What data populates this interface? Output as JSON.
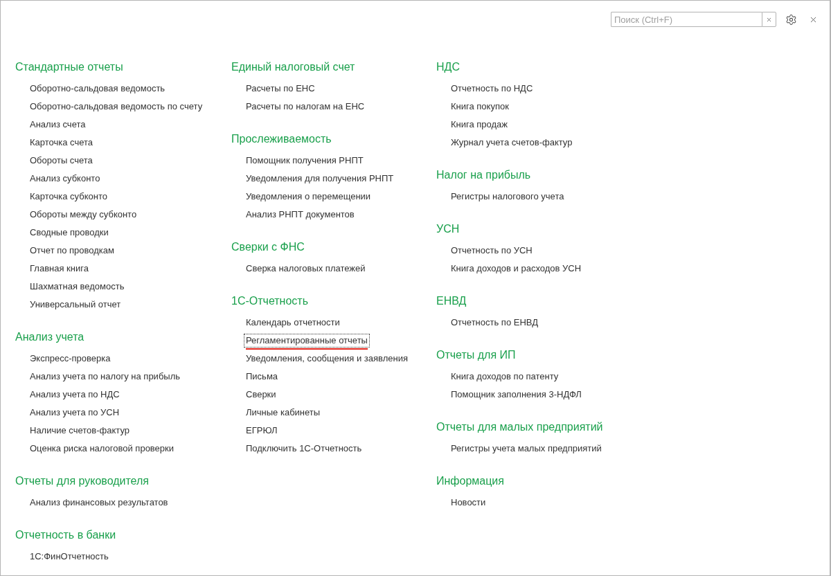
{
  "search": {
    "placeholder": "Поиск (Ctrl+F)"
  },
  "columns": [
    {
      "sections": [
        {
          "title": "Стандартные отчеты",
          "items": [
            {
              "label": "Оборотно-сальдовая ведомость",
              "selected": false
            },
            {
              "label": "Оборотно-сальдовая ведомость по счету",
              "selected": false
            },
            {
              "label": "Анализ счета",
              "selected": false
            },
            {
              "label": "Карточка счета",
              "selected": false
            },
            {
              "label": "Обороты счета",
              "selected": false
            },
            {
              "label": "Анализ субконто",
              "selected": false
            },
            {
              "label": "Карточка субконто",
              "selected": false
            },
            {
              "label": "Обороты между субконто",
              "selected": false
            },
            {
              "label": "Сводные проводки",
              "selected": false
            },
            {
              "label": "Отчет по проводкам",
              "selected": false
            },
            {
              "label": "Главная книга",
              "selected": false
            },
            {
              "label": "Шахматная ведомость",
              "selected": false
            },
            {
              "label": "Универсальный отчет",
              "selected": false
            }
          ]
        },
        {
          "title": "Анализ учета",
          "items": [
            {
              "label": "Экспресс-проверка",
              "selected": false
            },
            {
              "label": "Анализ учета по налогу на прибыль",
              "selected": false
            },
            {
              "label": "Анализ учета по НДС",
              "selected": false
            },
            {
              "label": "Анализ учета по УСН",
              "selected": false
            },
            {
              "label": "Наличие счетов-фактур",
              "selected": false
            },
            {
              "label": "Оценка риска налоговой проверки",
              "selected": false
            }
          ]
        },
        {
          "title": "Отчеты для руководителя",
          "items": [
            {
              "label": "Анализ финансовых результатов",
              "selected": false
            }
          ]
        },
        {
          "title": "Отчетность в банки",
          "items": [
            {
              "label": "1С:ФинОтчетность",
              "selected": false
            }
          ]
        }
      ]
    },
    {
      "sections": [
        {
          "title": "Единый налоговый счет",
          "items": [
            {
              "label": "Расчеты по ЕНС",
              "selected": false
            },
            {
              "label": "Расчеты по налогам на ЕНС",
              "selected": false
            }
          ]
        },
        {
          "title": "Прослеживаемость",
          "items": [
            {
              "label": "Помощник получения РНПТ",
              "selected": false
            },
            {
              "label": "Уведомления для получения РНПТ",
              "selected": false
            },
            {
              "label": "Уведомления о перемещении",
              "selected": false
            },
            {
              "label": "Анализ РНПТ документов",
              "selected": false
            }
          ]
        },
        {
          "title": "Сверки с ФНС",
          "items": [
            {
              "label": "Сверка налоговых платежей",
              "selected": false
            }
          ]
        },
        {
          "title": "1С-Отчетность",
          "items": [
            {
              "label": "Календарь отчетности",
              "selected": false
            },
            {
              "label": "Регламентированные отчеты",
              "selected": true
            },
            {
              "label": "Уведомления, сообщения и заявления",
              "selected": false
            },
            {
              "label": "Письма",
              "selected": false
            },
            {
              "label": "Сверки",
              "selected": false
            },
            {
              "label": "Личные кабинеты",
              "selected": false
            },
            {
              "label": "ЕГРЮЛ",
              "selected": false
            },
            {
              "label": "Подключить 1С-Отчетность",
              "selected": false
            }
          ]
        }
      ]
    },
    {
      "sections": [
        {
          "title": "НДС",
          "items": [
            {
              "label": "Отчетность по НДС",
              "selected": false
            },
            {
              "label": "Книга покупок",
              "selected": false
            },
            {
              "label": "Книга продаж",
              "selected": false
            },
            {
              "label": "Журнал учета счетов-фактур",
              "selected": false
            }
          ]
        },
        {
          "title": "Налог на прибыль",
          "items": [
            {
              "label": "Регистры налогового учета",
              "selected": false
            }
          ]
        },
        {
          "title": "УСН",
          "items": [
            {
              "label": "Отчетность по УСН",
              "selected": false
            },
            {
              "label": "Книга доходов и расходов УСН",
              "selected": false
            }
          ]
        },
        {
          "title": "ЕНВД",
          "items": [
            {
              "label": "Отчетность по ЕНВД",
              "selected": false
            }
          ]
        },
        {
          "title": "Отчеты для ИП",
          "items": [
            {
              "label": "Книга доходов по патенту",
              "selected": false
            },
            {
              "label": "Помощник заполнения 3-НДФЛ",
              "selected": false
            }
          ]
        },
        {
          "title": "Отчеты для малых предприятий",
          "items": [
            {
              "label": "Регистры учета малых предприятий",
              "selected": false
            }
          ]
        },
        {
          "title": "Информация",
          "items": [
            {
              "label": "Новости",
              "selected": false
            }
          ]
        }
      ]
    }
  ]
}
